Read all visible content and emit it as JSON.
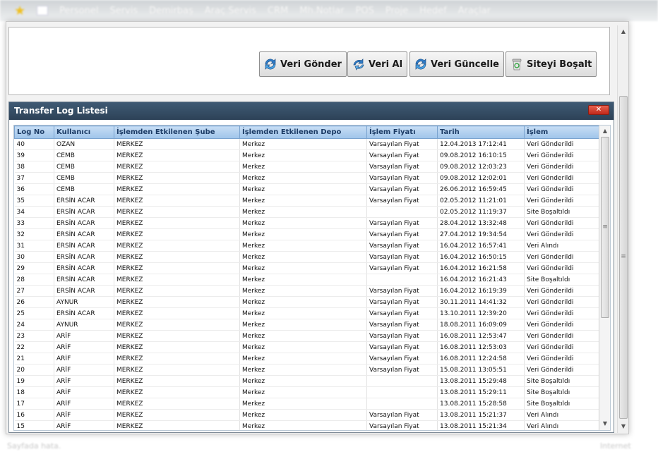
{
  "topnav": {
    "items": [
      "Personel",
      "Servis",
      "Demirbaş",
      "Araç Servis",
      "CRM",
      "Mh.Notlar",
      "POS",
      "Proje",
      "Hedef",
      "Araçlar"
    ]
  },
  "toolbar": {
    "send_label": "Veri Gönder",
    "receive_label": "Veri Al",
    "update_label": "Veri Güncelle",
    "clear_label": "Siteyi Boşalt"
  },
  "dialog": {
    "title": "Transfer Log Listesi",
    "close_label": "✕"
  },
  "table": {
    "headers": [
      "Log No",
      "Kullanıcı",
      "İşlemden Etkilenen Şube",
      "İşlemden Etkilenen Depo",
      "İşlem Fiyatı",
      "Tarih",
      "İşlem"
    ],
    "rows": [
      [
        "40",
        "OZAN",
        "MERKEZ",
        "Merkez",
        "Varsayılan Fiyat",
        "12.04.2013 17:12:41",
        "Veri Gönderildi"
      ],
      [
        "39",
        "CEMB",
        "MERKEZ",
        "Merkez",
        "Varsayılan Fiyat",
        "09.08.2012 16:10:15",
        "Veri Gönderildi"
      ],
      [
        "38",
        "CEMB",
        "MERKEZ",
        "Merkez",
        "Varsayılan Fiyat",
        "09.08.2012 12:03:23",
        "Veri Gönderildi"
      ],
      [
        "37",
        "CEMB",
        "MERKEZ",
        "Merkez",
        "Varsayılan Fiyat",
        "09.08.2012 12:02:01",
        "Veri Gönderildi"
      ],
      [
        "36",
        "CEMB",
        "MERKEZ",
        "Merkez",
        "Varsayılan Fiyat",
        "26.06.2012 16:59:45",
        "Veri Gönderildi"
      ],
      [
        "35",
        "ERSİN ACAR",
        "MERKEZ",
        "Merkez",
        "Varsayılan Fiyat",
        "02.05.2012 11:21:01",
        "Veri Gönderildi"
      ],
      [
        "34",
        "ERSİN ACAR",
        "MERKEZ",
        "Merkez",
        "",
        "02.05.2012 11:19:37",
        "Site Boşaltıldı"
      ],
      [
        "33",
        "ERSİN ACAR",
        "MERKEZ",
        "Merkez",
        "Varsayılan Fiyat",
        "28.04.2012 13:32:48",
        "Veri Gönderildi"
      ],
      [
        "32",
        "ERSİN ACAR",
        "MERKEZ",
        "Merkez",
        "Varsayılan Fiyat",
        "27.04.2012 19:34:54",
        "Veri Gönderildi"
      ],
      [
        "31",
        "ERSİN ACAR",
        "MERKEZ",
        "Merkez",
        "Varsayılan Fiyat",
        "16.04.2012 16:57:41",
        "Veri Alındı"
      ],
      [
        "30",
        "ERSİN ACAR",
        "MERKEZ",
        "Merkez",
        "Varsayılan Fiyat",
        "16.04.2012 16:50:15",
        "Veri Gönderildi"
      ],
      [
        "29",
        "ERSİN ACAR",
        "MERKEZ",
        "Merkez",
        "Varsayılan Fiyat",
        "16.04.2012 16:21:58",
        "Veri Gönderildi"
      ],
      [
        "28",
        "ERSİN ACAR",
        "MERKEZ",
        "Merkez",
        "",
        "16.04.2012 16:21:43",
        "Site Boşaltıldı"
      ],
      [
        "27",
        "ERSİN ACAR",
        "MERKEZ",
        "Merkez",
        "Varsayılan Fiyat",
        "16.04.2012 16:19:39",
        "Veri Gönderildi"
      ],
      [
        "26",
        "AYNUR",
        "MERKEZ",
        "Merkez",
        "Varsayılan Fiyat",
        "30.11.2011 14:41:32",
        "Veri Gönderildi"
      ],
      [
        "25",
        "ERSİN ACAR",
        "MERKEZ",
        "Merkez",
        "Varsayılan Fiyat",
        "13.10.2011 12:39:20",
        "Veri Gönderildi"
      ],
      [
        "24",
        "AYNUR",
        "MERKEZ",
        "Merkez",
        "Varsayılan Fiyat",
        "18.08.2011 16:09:09",
        "Veri Gönderildi"
      ],
      [
        "23",
        "ARİF",
        "MERKEZ",
        "Merkez",
        "Varsayılan Fiyat",
        "16.08.2011 12:53:47",
        "Veri Gönderildi"
      ],
      [
        "22",
        "ARİF",
        "MERKEZ",
        "Merkez",
        "Varsayılan Fiyat",
        "16.08.2011 12:53:03",
        "Veri Gönderildi"
      ],
      [
        "21",
        "ARİF",
        "MERKEZ",
        "Merkez",
        "Varsayılan Fiyat",
        "16.08.2011 12:24:58",
        "Veri Gönderildi"
      ],
      [
        "20",
        "ARİF",
        "MERKEZ",
        "Merkez",
        "Varsayılan Fiyat",
        "15.08.2011 13:05:51",
        "Veri Gönderildi"
      ],
      [
        "19",
        "ARİF",
        "MERKEZ",
        "Merkez",
        "",
        "13.08.2011 15:29:48",
        "Site Boşaltıldı"
      ],
      [
        "18",
        "ARİF",
        "MERKEZ",
        "Merkez",
        "",
        "13.08.2011 15:29:11",
        "Site Boşaltıldı"
      ],
      [
        "17",
        "ARİF",
        "MERKEZ",
        "Merkez",
        "",
        "13.08.2011 15:28:58",
        "Site Boşaltıldı"
      ],
      [
        "16",
        "ARİF",
        "MERKEZ",
        "Merkez",
        "Varsayılan Fiyat",
        "13.08.2011 15:21:37",
        "Veri Alındı"
      ],
      [
        "15",
        "ARİF",
        "MERKEZ",
        "Merkez",
        "Varsayılan Fiyat",
        "13.08.2011 15:21:34",
        "Veri Alındı"
      ]
    ]
  },
  "statusbar": {
    "left": "Sayfada hata.",
    "right": "Internet"
  },
  "colors": {
    "header_bg": "#2d4257",
    "grid_header": "#b3d1f0",
    "close_red": "#d23a28"
  }
}
